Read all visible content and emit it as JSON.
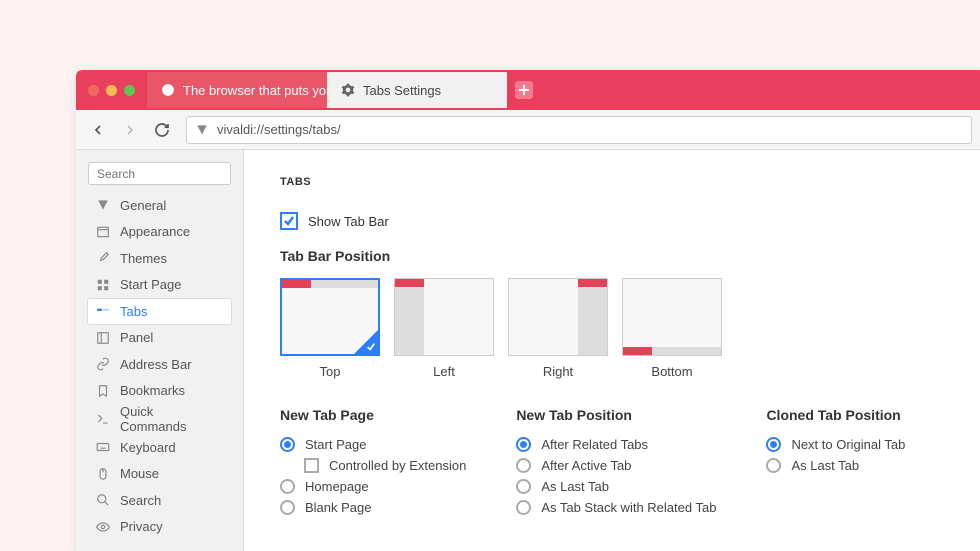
{
  "tabs": {
    "inactive": "The browser that puts you i",
    "active": "Tabs Settings"
  },
  "url": "vivaldi://settings/tabs/",
  "sidebar": {
    "search_placeholder": "Search",
    "items": [
      {
        "label": "General",
        "icon": "v"
      },
      {
        "label": "Appearance",
        "icon": "window"
      },
      {
        "label": "Themes",
        "icon": "brush"
      },
      {
        "label": "Start Page",
        "icon": "grid"
      },
      {
        "label": "Tabs",
        "icon": "tabs"
      },
      {
        "label": "Panel",
        "icon": "panel"
      },
      {
        "label": "Address Bar",
        "icon": "link"
      },
      {
        "label": "Bookmarks",
        "icon": "bookmark"
      },
      {
        "label": "Quick Commands",
        "icon": "prompt"
      },
      {
        "label": "Keyboard",
        "icon": "keyboard"
      },
      {
        "label": "Mouse",
        "icon": "mouse"
      },
      {
        "label": "Search",
        "icon": "search"
      },
      {
        "label": "Privacy",
        "icon": "eye"
      }
    ]
  },
  "content": {
    "section_title": "TABS",
    "show_tab_bar": "Show Tab Bar",
    "tab_bar_position_title": "Tab Bar Position",
    "positions": [
      "Top",
      "Left",
      "Right",
      "Bottom"
    ],
    "new_tab_page": {
      "title": "New Tab Page",
      "options": [
        "Start Page",
        "Homepage",
        "Blank Page"
      ],
      "controlled": "Controlled by Extension"
    },
    "new_tab_position": {
      "title": "New Tab Position",
      "options": [
        "After Related Tabs",
        "After Active Tab",
        "As Last Tab",
        "As Tab Stack with Related Tab"
      ]
    },
    "cloned_tab_position": {
      "title": "Cloned Tab Position",
      "options": [
        "Next to Original Tab",
        "As Last Tab"
      ]
    }
  }
}
